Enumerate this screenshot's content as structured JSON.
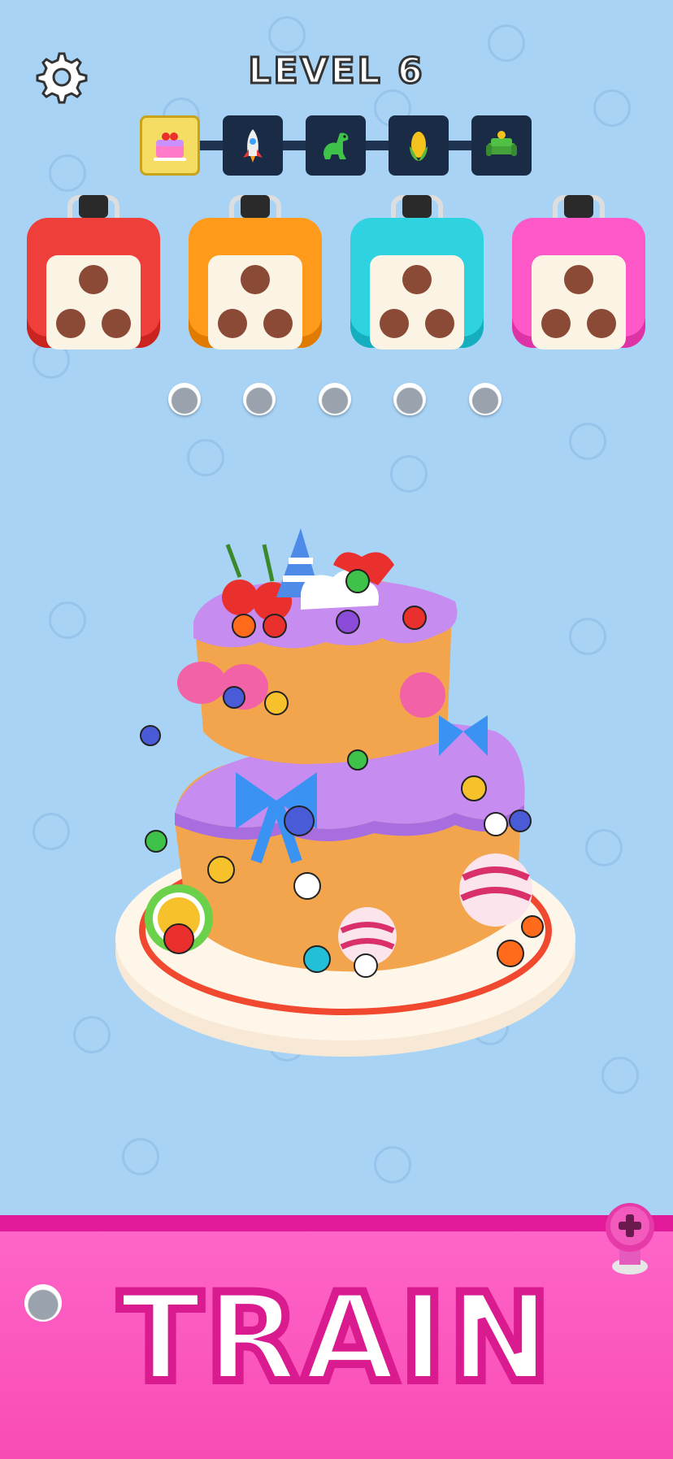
{
  "header": {
    "level_label": "LEVEL 6",
    "settings_icon": "gear-icon"
  },
  "progress": {
    "items": [
      {
        "icon": "cake-icon",
        "state": "current"
      },
      {
        "icon": "rocket-icon",
        "state": "locked"
      },
      {
        "icon": "dinosaur-icon",
        "state": "locked"
      },
      {
        "icon": "corn-icon",
        "state": "locked"
      },
      {
        "icon": "sofa-icon",
        "state": "locked"
      }
    ]
  },
  "boxes": [
    {
      "color": "#ef3f3a",
      "holes": 3
    },
    {
      "color": "#ff9a1a",
      "holes": 3
    },
    {
      "color": "#2ed2e0",
      "holes": 3
    },
    {
      "color": "#ff58c8",
      "holes": 3
    }
  ],
  "slots": {
    "count": 5
  },
  "banner": {
    "label": "TRAIN",
    "color": "#f84bb5",
    "plus_icon": "plus-icon"
  }
}
